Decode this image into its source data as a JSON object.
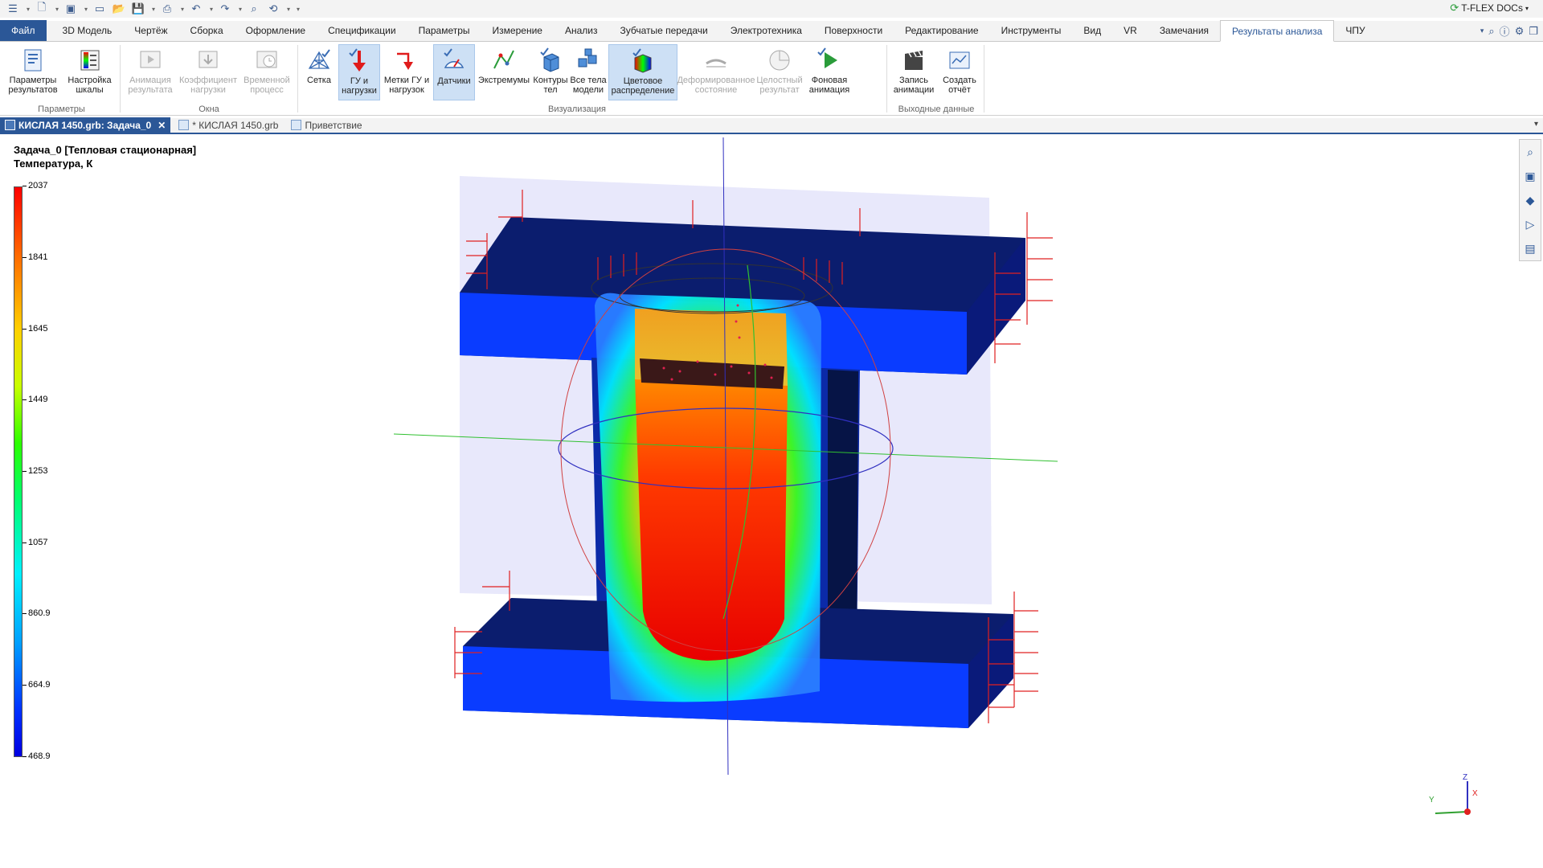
{
  "app": {
    "docs_button": "T-FLEX DOCs"
  },
  "menu": {
    "tabs": [
      "Файл",
      "3D Модель",
      "Чертёж",
      "Сборка",
      "Оформление",
      "Спецификации",
      "Параметры",
      "Измерение",
      "Анализ",
      "Зубчатые передачи",
      "Электротехника",
      "Поверхности",
      "Редактирование",
      "Инструменты",
      "Вид",
      "VR",
      "Замечания",
      "Результаты анализа",
      "ЧПУ"
    ],
    "active": "Результаты анализа"
  },
  "ribbon": {
    "groups": {
      "params": "Параметры",
      "windows": "Окна",
      "visual": "Визуализация",
      "output": "Выходные данные"
    },
    "buttons": {
      "result_params": "Параметры\nрезультатов",
      "scale_settings": "Настройка\nшкалы",
      "result_anim": "Анимация\nрезультата",
      "load_coef": "Коэффициент\nнагрузки",
      "time_process": "Временной\nпроцесс",
      "mesh": "Сетка",
      "bc_loads": "ГУ и\nнагрузки",
      "bc_marks": "Метки ГУ и\nнагрузок",
      "sensors": "Датчики",
      "extremes": "Экстремумы",
      "body_contours": "Контуры\nтел",
      "all_bodies": "Все тела\nмодели",
      "color_dist": "Цветовое\nраспределение",
      "deformed": "Деформированное\nсостояние",
      "integral": "Целостный\nрезультат",
      "bg_anim": "Фоновая\nанимация",
      "record_anim": "Запись\nанимации",
      "create_report": "Создать\nотчёт"
    }
  },
  "doc_tabs": {
    "active": "КИСЛАЯ 1450.grb: Задача_0",
    "second": "* КИСЛАЯ 1450.grb",
    "third": "Приветствие"
  },
  "viewport": {
    "title": "Задача_0 [Тепловая стационарная]",
    "subtitle": "Температура, К",
    "scale_labels": [
      "2037",
      "1841",
      "1645",
      "1449",
      "1253",
      "1057",
      "860.9",
      "664.9",
      "468.9"
    ],
    "axis_labels": {
      "x": "X",
      "y": "Y",
      "z": "Z"
    }
  },
  "colors": {
    "accent": "#2b5797",
    "selected": "#cde0f5"
  }
}
